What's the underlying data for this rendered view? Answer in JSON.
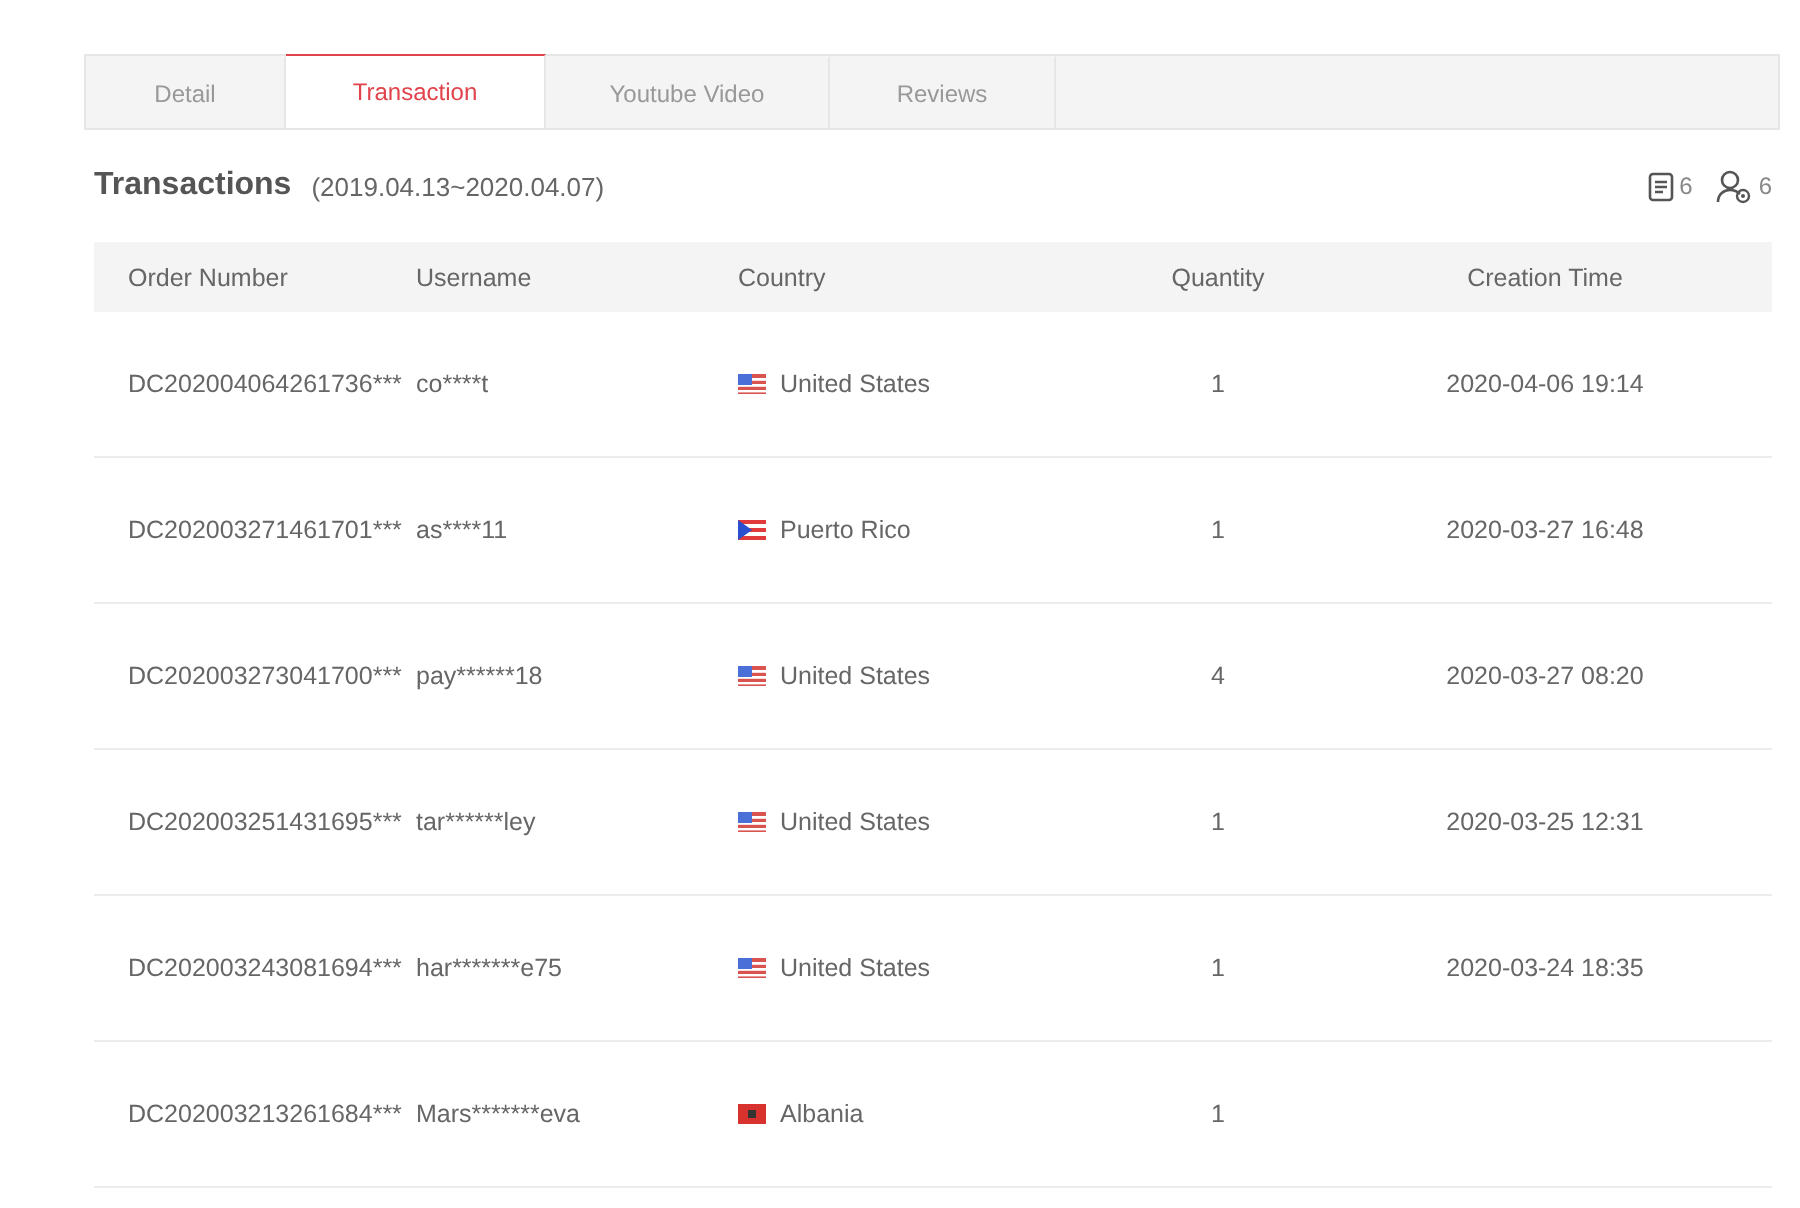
{
  "tabs": [
    {
      "label": "Detail",
      "selected": false
    },
    {
      "label": "Transaction",
      "selected": true
    },
    {
      "label": "Youtube Video",
      "selected": false
    },
    {
      "label": "Reviews",
      "selected": false
    }
  ],
  "section": {
    "title": "Transactions",
    "date_range": "(2019.04.13~2020.04.07)",
    "document_count": "6",
    "user_count": "6"
  },
  "table": {
    "columns": [
      "Order Number",
      "Username",
      "Country",
      "Quantity",
      "Creation Time"
    ],
    "rows": [
      {
        "order_number": "DC202004064261736***",
        "username": "co****t",
        "kind": "us",
        "country": "United States",
        "quantity": "1",
        "creation_time": "2020-04-06 19:14"
      },
      {
        "order_number": "DC202003271461701***",
        "username": "as****11",
        "kind": "pr",
        "country": "Puerto Rico",
        "quantity": "1",
        "creation_time": "2020-03-27 16:48"
      },
      {
        "order_number": "DC202003273041700***",
        "username": "pay******18",
        "kind": "us",
        "country": "United States",
        "quantity": "4",
        "creation_time": "2020-03-27 08:20"
      },
      {
        "order_number": "DC202003251431695***",
        "username": "tar******ley",
        "kind": "us",
        "country": "United States",
        "quantity": "1",
        "creation_time": "2020-03-25 12:31"
      },
      {
        "order_number": "DC202003243081694***",
        "username": "har*******e75",
        "kind": "us",
        "country": "United States",
        "quantity": "1",
        "creation_time": "2020-03-24 18:35"
      },
      {
        "order_number": "DC202003213261684***",
        "username": "Mars*******eva",
        "kind": "al",
        "country": "Albania",
        "quantity": "1"
      }
    ]
  }
}
